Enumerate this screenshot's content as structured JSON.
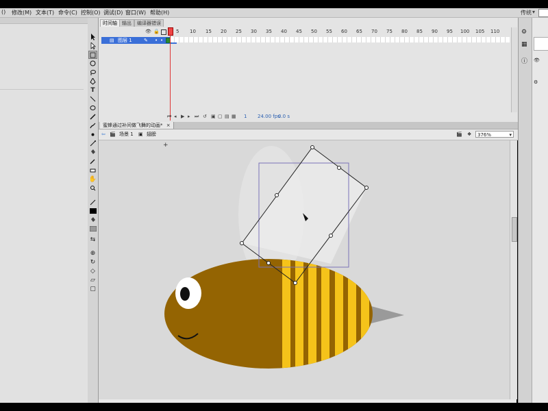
{
  "menubar": {
    "items": [
      "()",
      "修改(M)",
      "文本(T)",
      "命令(C)",
      "控制(O)",
      "调试(D)",
      "窗口(W)",
      "帮助(H)"
    ],
    "workspace": "传统"
  },
  "timeline": {
    "tabs": [
      "时间轴",
      "输出",
      "编译器错误"
    ],
    "ruler": [
      "5",
      "10",
      "15",
      "20",
      "25",
      "30",
      "35",
      "40",
      "45",
      "50",
      "55",
      "60",
      "65",
      "70",
      "75",
      "80",
      "85",
      "90",
      "95",
      "100",
      "105",
      "110"
    ],
    "layer_name": "图层 1",
    "fps": "24.00 fps",
    "time": "0.0 s",
    "frame": "1"
  },
  "document": {
    "tab_label": "蜜蜂通过补间做飞舞的动画*",
    "scene": "场景 1",
    "symbol": "翅膀",
    "zoom": "376%"
  },
  "colors": {
    "bee_body": "#946402",
    "stripe": "#f5c31a",
    "wing": "#ececec",
    "stage_bg": "#d9d9d9",
    "layer_selected": "#3a6fd8",
    "playhead": "#dd3333"
  },
  "icons": {
    "layer": "layer-icon",
    "scene": "scene-icon",
    "symbol": "graphic-symbol-icon",
    "back": "back-arrow-icon"
  }
}
